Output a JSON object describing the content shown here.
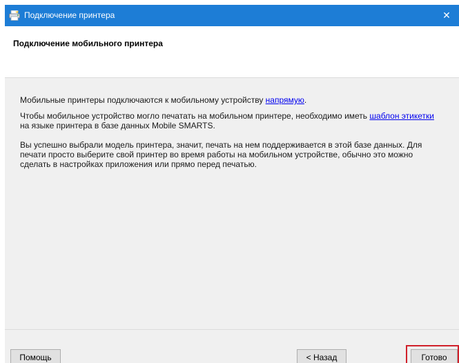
{
  "window": {
    "title": "Подключение принтера",
    "close_glyph": "✕",
    "icon": "printer-wizard-icon"
  },
  "header": {
    "title": "Подключение мобильного принтера"
  },
  "content": {
    "p1_text": "Мобильные принтеры подключаются к мобильному устройству ",
    "p1_link": "напрямую",
    "p1_end": ".",
    "p2_text": "Чтобы мобильное устройство могло печатать на мобильном принтере, необходимо иметь ",
    "p2_link": "шаблон этикетки",
    "p2_end": " на языке принтера в базе данных Mobile SMARTS.",
    "p3_text": "Вы успешно выбрали модель принтера, значит, печать на нем поддерживается в этой базе данных. Для печати просто выберите свой принтер во время работы на мобильном устройстве, обычно это можно сделать в настройках приложения или прямо перед печатью."
  },
  "footer": {
    "help_label": "Помощь",
    "back_label": "< Назад",
    "done_label": "Готово"
  },
  "colors": {
    "titlebar": "#1d7dd6",
    "link": "#0000ee",
    "highlight": "#d0202a"
  }
}
